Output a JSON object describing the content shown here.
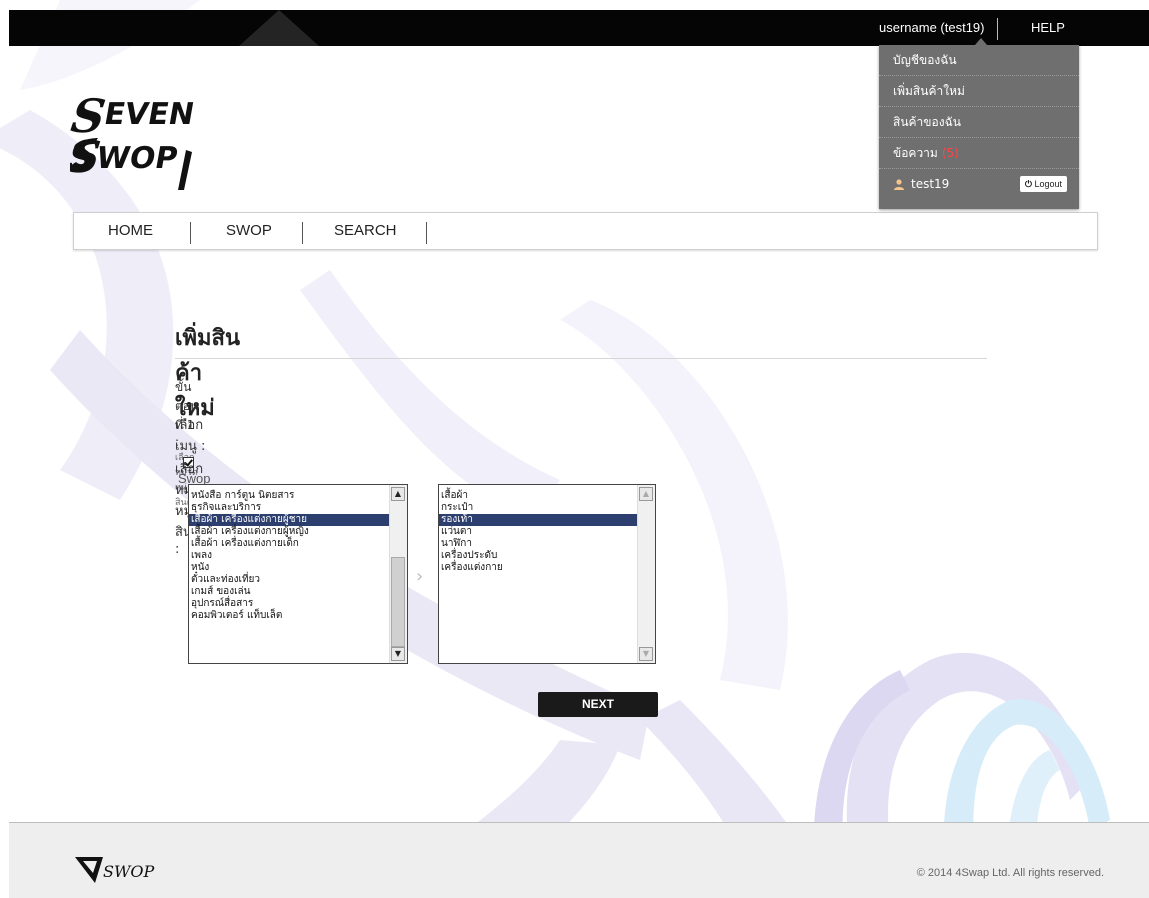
{
  "topbar": {
    "username": "username (test19)",
    "help": "HELP"
  },
  "account_menu": {
    "items": [
      {
        "label": "บัญชีของฉัน"
      },
      {
        "label": "เพิ่มสินค้าใหม่"
      },
      {
        "label": "สินค้าของฉัน"
      },
      {
        "label": "ข้อความ",
        "badge": "(5)"
      }
    ],
    "user": "test19",
    "logout": "Logout"
  },
  "logo": {
    "text": "SEVEN SWOP"
  },
  "nav": {
    "items": [
      "HOME",
      "SWOP",
      "SEARCH"
    ]
  },
  "page": {
    "title": "เพิ่มสินค้าใหม่",
    "step_label": "ขั้นตอนที่ 1 :",
    "step_sub": "เลือกหมวดหมู่สินค้า",
    "menu_label": "เลือกเมนู :",
    "menu_option": "Swop",
    "category_label": "เลือกหมวดหมู่สินค้า :",
    "next_button": "NEXT"
  },
  "category_list": {
    "selected_index": 2,
    "items": [
      "หนังสือ การ์ตูน นิตยสาร",
      "ธุรกิจและบริการ",
      "เสื้อผ้า เครื่องแต่งกายผู้ชาย",
      "เสื้อผ้า เครื่องแต่งกายผู้หญิง",
      "เสื้อผ้า เครื่องแต่งกายเด็ก",
      "เพลง",
      "หนัง",
      "ตั๋วและท่องเที่ยว",
      "เกมส์ ของเล่น",
      "อุปกรณ์สื่อสาร",
      "คอมพิวเตอร์ แท็บเล็ต"
    ]
  },
  "subcategory_list": {
    "selected_index": 2,
    "items": [
      "เสื้อผ้า",
      "กระเป๋า",
      "รองเท้า",
      "แว่นตา",
      "นาฬิกา",
      "เครื่องประดับ",
      "เครื่องแต่งกาย"
    ]
  },
  "footer": {
    "logo_text": "SWOP",
    "copyright": "© 2014 4Swap Ltd. All rights reserved."
  },
  "colors": {
    "topbar": "#050505",
    "menu_bg": "#6f6f6f",
    "selection": "#2c3f6e",
    "deco_purple": "#e6e3f5",
    "deco_blue": "#d9eef9"
  }
}
